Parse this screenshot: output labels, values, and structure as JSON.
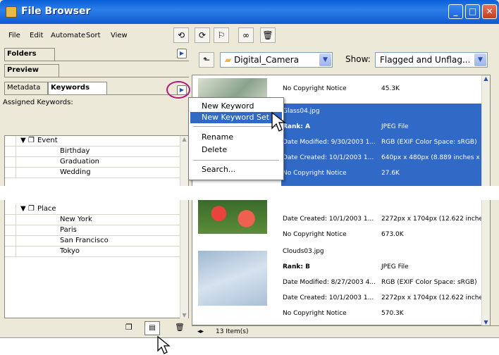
{
  "window": {
    "title": "File Browser",
    "controls": {
      "minimize": "_",
      "maximize": "□",
      "close": "✕"
    }
  },
  "menubar": {
    "items": [
      "File",
      "Edit",
      "Automate",
      "Sort",
      "View"
    ]
  },
  "toolbar": {
    "icons": [
      "rotate-ccw-icon",
      "rotate-cw-icon",
      "flag-icon",
      "binoculars-icon",
      "trash-icon"
    ]
  },
  "tabs": {
    "folders": "Folders",
    "preview": "Preview",
    "metadata": "Metadata",
    "keywords": "Keywords"
  },
  "keywords": {
    "assigned_label": "Assigned Keywords:",
    "groups_top": [
      {
        "name": "Event",
        "items": [
          "Birthday",
          "Graduation",
          "Wedding"
        ]
      }
    ],
    "groups_bottom": [
      {
        "name": "Place",
        "items": [
          "New York",
          "Paris",
          "San Francisco",
          "Tokyo"
        ]
      }
    ]
  },
  "folder_bar": {
    "folder": "Digital_Camera",
    "show_label": "Show:",
    "show_value": "Flagged and Unflag..."
  },
  "files_top": {
    "row1": {
      "a": "No Copyright Notice",
      "b": "45.3K"
    },
    "selected": {
      "name": "Glass04.jpg",
      "rank": "Rank: A",
      "type": "JPEG File",
      "modified": "Date Modified: 9/30/2003  1...",
      "color": "RGB (EXIF Color Space: sRGB)",
      "created": "Date Created: 10/1/2003  1...",
      "dims": "640px x 480px (8.889 inches x 6.",
      "copyright": "No Copyright Notice",
      "size": "27.6K"
    }
  },
  "files_bottom": {
    "row1": {
      "a": "Date Created: 10/1/2003  1...",
      "b": "2272px x 1704px (12.622 inches :"
    },
    "row2": {
      "a": "No Copyright Notice",
      "b": "673.0K"
    },
    "clouds": {
      "name": "Clouds03.jpg",
      "rank": "Rank: B",
      "type": "JPEG File",
      "modified": "Date Modified: 8/27/2003  4...",
      "color": "RGB (EXIF Color Space: sRGB)",
      "created": "Date Created: 10/1/2003  1...",
      "dims": "2272px x 1704px (12.622 inches :",
      "copyright": "No Copyright Notice",
      "size": "570.3K"
    }
  },
  "context_menu": {
    "items": [
      "New Keyword",
      "New Keyword Set",
      "Rename",
      "Delete",
      "Search..."
    ],
    "highlighted": "New Keyword Set"
  },
  "status": {
    "count": "13 Item(s)"
  },
  "colors": {
    "selection": "#3169c6",
    "titlebar": "#0a5fd9",
    "panel": "#ece9d8",
    "highlight_circle": "#b0187c"
  }
}
